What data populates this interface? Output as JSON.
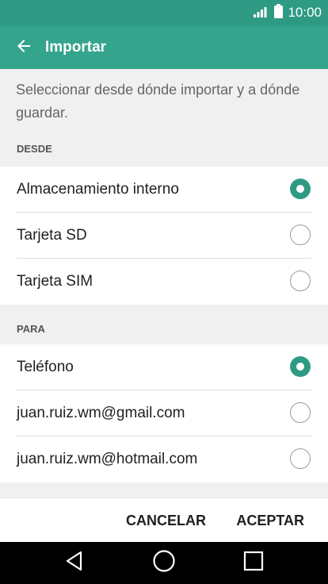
{
  "status_bar": {
    "time": "10:00",
    "icons": [
      "signal-icon",
      "battery-icon"
    ]
  },
  "app_bar": {
    "title": "Importar",
    "back_icon": "arrow-left-icon"
  },
  "description": "Seleccionar desde dónde importar y a dónde guardar.",
  "sections": [
    {
      "header": "DESDE",
      "items": [
        {
          "label": "Almacenamiento interno",
          "selected": true
        },
        {
          "label": "Tarjeta SD",
          "selected": false
        },
        {
          "label": "Tarjeta SIM",
          "selected": false
        }
      ]
    },
    {
      "header": "PARA",
      "items": [
        {
          "label": "Teléfono",
          "selected": true
        },
        {
          "label": "juan.ruiz.wm@gmail.com",
          "selected": false
        },
        {
          "label": "juan.ruiz.wm@hotmail.com",
          "selected": false
        }
      ]
    }
  ],
  "actions": {
    "cancel": "CANCELAR",
    "accept": "ACEPTAR"
  },
  "nav_bar": {
    "icons": [
      "nav-back-icon",
      "nav-home-icon",
      "nav-recents-icon"
    ]
  },
  "colors": {
    "status_bar": "#2f9a84",
    "app_bar": "#35a48d",
    "accent": "#2f9a84"
  }
}
